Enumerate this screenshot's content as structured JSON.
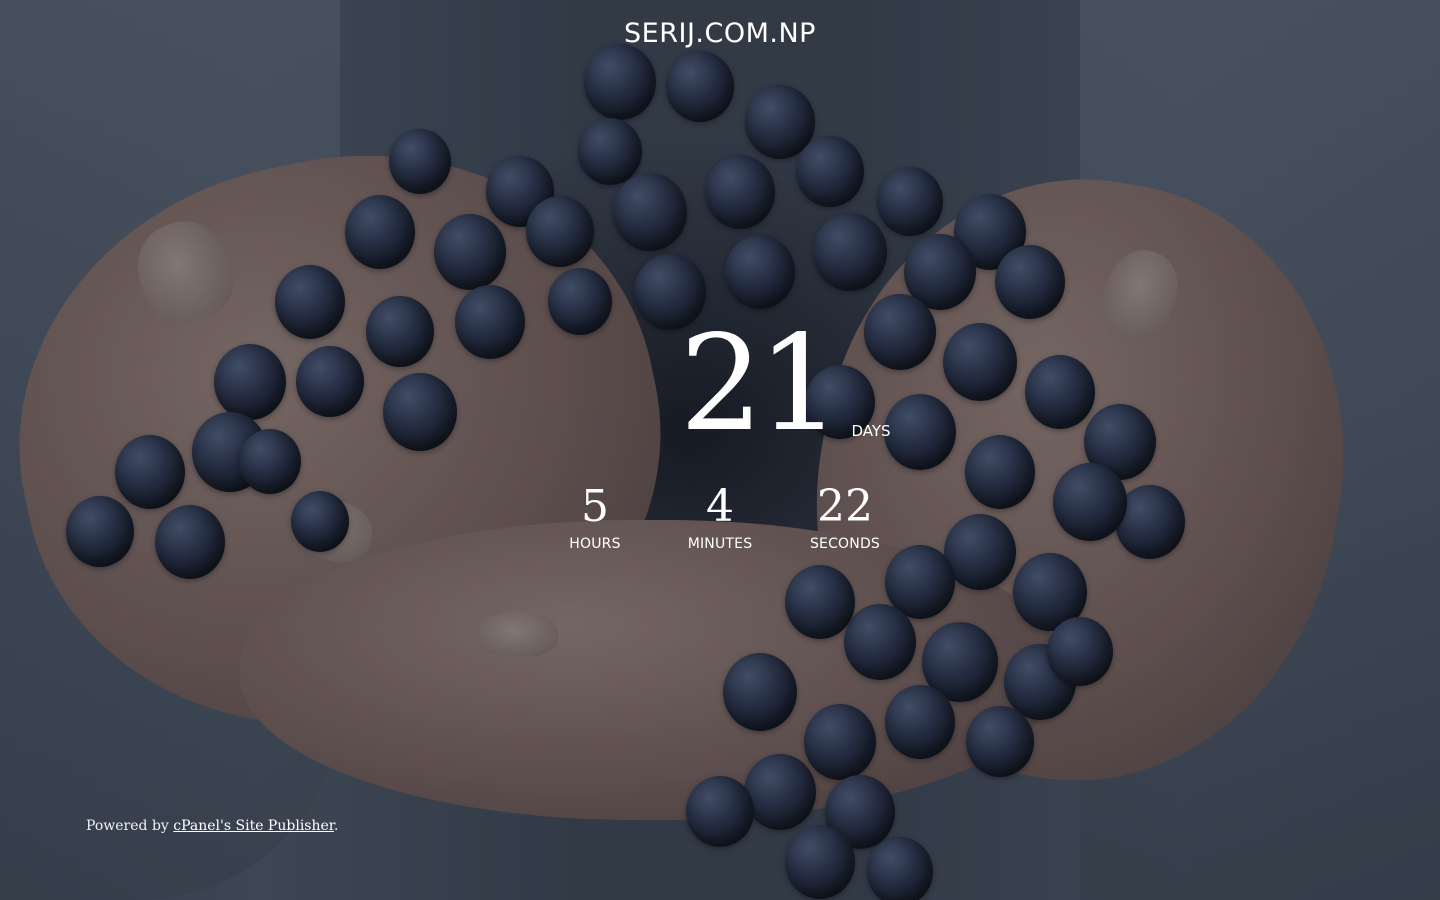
{
  "header": {
    "site_title": "SERIJ.COM.NP"
  },
  "countdown": {
    "days": {
      "value": "21",
      "label": "DAYS"
    },
    "hours": {
      "value": "5",
      "label": "HOURS"
    },
    "minutes": {
      "value": "4",
      "label": "MINUTES"
    },
    "seconds": {
      "value": "22",
      "label": "SECONDS"
    }
  },
  "footer": {
    "prefix": "Powered by ",
    "link_text": "cPanel's Site Publisher",
    "suffix": "."
  },
  "colors": {
    "text": "#ffffff",
    "background_overlay": "#2c3440",
    "grape": "#29324a"
  }
}
